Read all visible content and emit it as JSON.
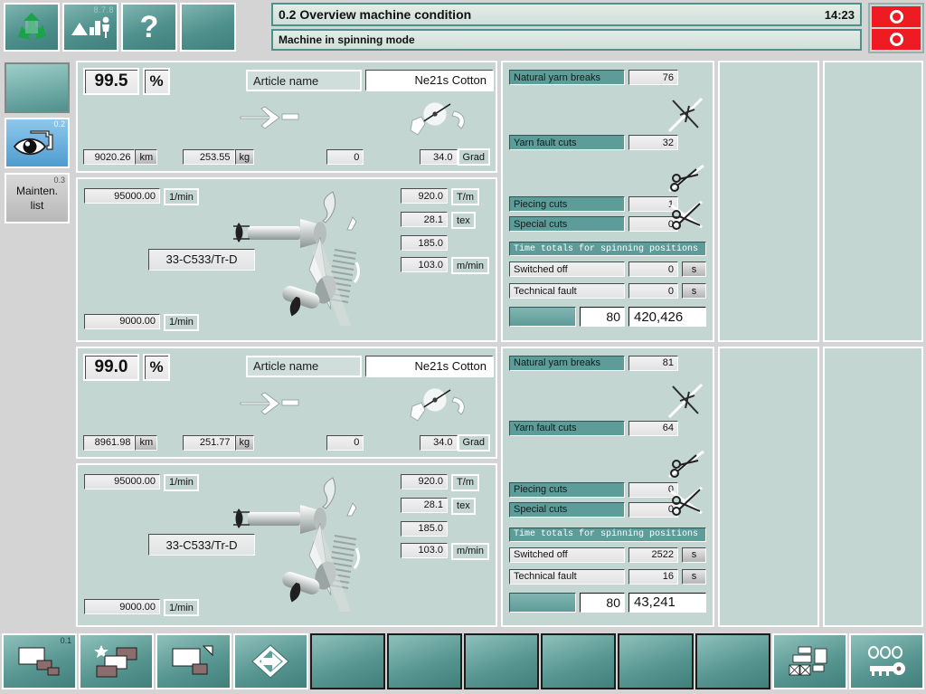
{
  "header": {
    "version_label": "8.7.8",
    "title": "0.2 Overview machine condition",
    "clock": "14:23",
    "status": "Machine in spinning mode",
    "buttons": [
      {
        "name": "recycle-button",
        "icon": "recycle-icon"
      },
      {
        "name": "machine-operator-button",
        "icon": "machine-operator-icon"
      },
      {
        "name": "help-button",
        "icon": "question-mark-icon",
        "label": "?"
      },
      {
        "name": "blank-button",
        "icon": "blank-icon"
      }
    ],
    "alarm": {
      "name": "alarm-indicator",
      "cells": 2,
      "color": "#ee1c22"
    }
  },
  "sidebar": {
    "items": [
      {
        "name": "sidebar-status-block",
        "num": "",
        "label": ""
      },
      {
        "name": "sidebar-item-overview",
        "num": "0.2",
        "label": ""
      },
      {
        "name": "sidebar-item-maintenance-list",
        "num": "0.3",
        "label_line1": "Mainten.",
        "label_line2": "list"
      }
    ]
  },
  "machines": [
    {
      "efficiency": "99.5",
      "pct": "%",
      "article_label": "Article name",
      "article_value": "Ne21s  Cotton",
      "length": "9020.26",
      "length_unit": "km",
      "weight": "253.55",
      "weight_unit": "kg",
      "doffs": "0",
      "angle": "34.0",
      "angle_unit": "Grad",
      "rotor_speed": "95000.00",
      "rotor_speed_unit": "1/min",
      "opener_speed": "9000.00",
      "opener_speed_unit": "1/min",
      "machine_type": "33-C533/Tr-D",
      "twist": "920.0",
      "twist_unit": "T/m",
      "count": "28.1",
      "count_unit": "tex",
      "takeoff": "185.0",
      "delivery": "103.0",
      "delivery_unit": "m/min",
      "stats": {
        "natural_yarn_breaks_label": "Natural yarn breaks",
        "natural_yarn_breaks_value": "76",
        "yarn_fault_cuts_label": "Yarn fault cuts",
        "yarn_fault_cuts_value": "32",
        "piecing_cuts_label": "Piecing cuts",
        "piecing_cuts_value": "1",
        "special_cuts_label": "Special cuts",
        "special_cuts_value": "0",
        "time_totals_header": "Time totals for spinning positions",
        "switched_off_label": "Switched off",
        "switched_off_value": "0",
        "switched_off_unit": "s",
        "technical_fault_label": "Technical fault",
        "technical_fault_value": "0",
        "technical_fault_unit": "s",
        "positions": "80",
        "total": "420,426"
      }
    },
    {
      "efficiency": "99.0",
      "pct": "%",
      "article_label": "Article name",
      "article_value": "Ne21s  Cotton",
      "length": "8961.98",
      "length_unit": "km",
      "weight": "251.77",
      "weight_unit": "kg",
      "doffs": "0",
      "angle": "34.0",
      "angle_unit": "Grad",
      "rotor_speed": "95000.00",
      "rotor_speed_unit": "1/min",
      "opener_speed": "9000.00",
      "opener_speed_unit": "1/min",
      "machine_type": "33-C533/Tr-D",
      "twist": "920.0",
      "twist_unit": "T/m",
      "count": "28.1",
      "count_unit": "tex",
      "takeoff": "185.0",
      "delivery": "103.0",
      "delivery_unit": "m/min",
      "stats": {
        "natural_yarn_breaks_label": "Natural yarn breaks",
        "natural_yarn_breaks_value": "81",
        "yarn_fault_cuts_label": "Yarn fault cuts",
        "yarn_fault_cuts_value": "64",
        "piecing_cuts_label": "Piecing cuts",
        "piecing_cuts_value": "0",
        "special_cuts_label": "Special cuts",
        "special_cuts_value": "0",
        "time_totals_header": "Time totals for spinning positions",
        "switched_off_label": "Switched off",
        "switched_off_value": "2522",
        "switched_off_unit": "s",
        "technical_fault_label": "Technical fault",
        "technical_fault_value": "16",
        "technical_fault_unit": "s",
        "positions": "80",
        "total": "43,241"
      }
    }
  ],
  "footer": {
    "buttons": [
      {
        "name": "footer-windows-button",
        "num": "0.1",
        "icon": "windows-overlap-icon"
      },
      {
        "name": "footer-favorite-button",
        "num": "",
        "icon": "star-windows-icon"
      },
      {
        "name": "footer-window-tag-button",
        "num": "",
        "icon": "window-tag-icon"
      },
      {
        "name": "footer-next-button",
        "num": "",
        "icon": "arrow-diamond-icon"
      },
      {
        "name": "footer-blank-1",
        "num": "",
        "icon": "blank-icon"
      },
      {
        "name": "footer-blank-2",
        "num": "",
        "icon": "blank-icon"
      },
      {
        "name": "footer-blank-3",
        "num": "",
        "icon": "blank-icon"
      },
      {
        "name": "footer-blank-4",
        "num": "",
        "icon": "blank-icon"
      },
      {
        "name": "footer-blank-5",
        "num": "",
        "icon": "blank-icon"
      },
      {
        "name": "footer-blank-6",
        "num": "",
        "icon": "blank-icon"
      },
      {
        "name": "footer-network-button",
        "num": "",
        "icon": "network-grid-icon"
      },
      {
        "name": "footer-key-button",
        "num": "",
        "icon": "key-icon"
      }
    ]
  },
  "colors": {
    "teal_label": "#5d9c99",
    "panel_bg": "#c3d6d1",
    "chrome_bg": "#d4d4d4",
    "alarm_red": "#ee1c22",
    "button_teal": "#4e908c"
  }
}
